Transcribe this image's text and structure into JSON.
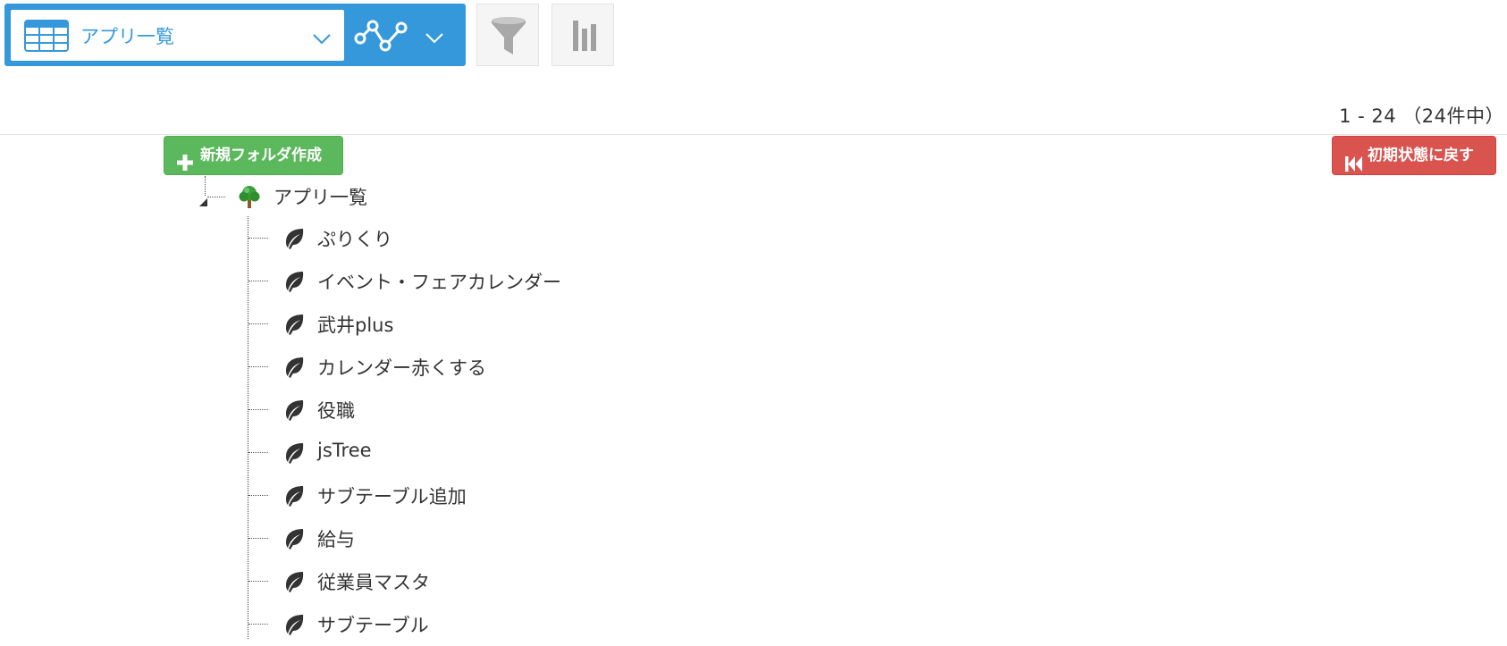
{
  "toolbar": {
    "view_name": "アプリ一覧",
    "accent_color": "#3498db",
    "icons": [
      "table-icon",
      "chevron-down-icon",
      "graph-icon",
      "filter-icon",
      "bar-chart-icon"
    ]
  },
  "pagination": {
    "text": "1 - 24 （24件中）"
  },
  "actions": {
    "new_folder_label": "新規フォルダ作成",
    "reset_label": "初期状態に戻す",
    "new_folder_color": "#5cb85c",
    "reset_color": "#d9534f"
  },
  "tree": {
    "root_label": "アプリ一覧",
    "items": [
      {
        "label": "ぷりくり"
      },
      {
        "label": "イベント・フェアカレンダー"
      },
      {
        "label": "武井plus"
      },
      {
        "label": "カレンダー赤くする"
      },
      {
        "label": "役職"
      },
      {
        "label": "jsTree"
      },
      {
        "label": "サブテーブル追加"
      },
      {
        "label": "給与"
      },
      {
        "label": "従業員マスタ"
      },
      {
        "label": "サブテーブル"
      }
    ]
  }
}
